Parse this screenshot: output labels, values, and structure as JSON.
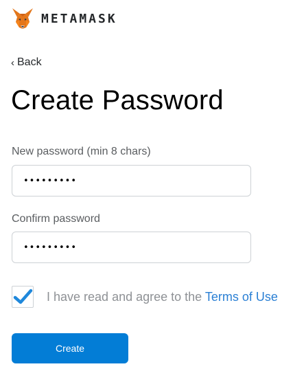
{
  "header": {
    "brand": "METAMASK",
    "logo_icon": "metamask-fox-icon"
  },
  "nav": {
    "back_label": "Back",
    "back_icon": "chevron-left-icon"
  },
  "page": {
    "title": "Create Password"
  },
  "form": {
    "new_password": {
      "label": "New password (min 8 chars)",
      "value": "•••••••••"
    },
    "confirm_password": {
      "label": "Confirm password",
      "value": "•••••••••"
    },
    "terms": {
      "checked": true,
      "check_icon": "checkmark-icon",
      "text": "I have read and agree to the ",
      "link": "Terms of Use"
    },
    "submit_label": "Create"
  },
  "colors": {
    "accent": "#037dd6",
    "link": "#2a7fd4",
    "check": "#1f88db",
    "fox_orange": "#e2761b"
  }
}
